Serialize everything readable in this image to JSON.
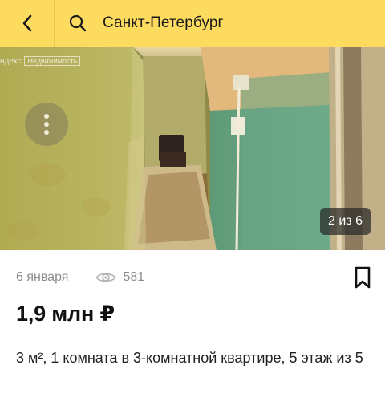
{
  "header": {
    "back_icon": "chevron-left-icon",
    "search_icon": "search-icon",
    "city": "Санкт-Петербург",
    "background_color": "#fddb5f"
  },
  "gallery": {
    "watermark_brand": "ндекс",
    "watermark_label": "Недвижимость",
    "more_icon": "vertical-dots-icon",
    "counter": "2 из 6"
  },
  "listing": {
    "date": "6 января",
    "views_icon": "eye-icon",
    "views": "581",
    "bookmark_icon": "bookmark-icon",
    "price": "1,9 млн ₽",
    "description": "3 м², 1 комната в 3-комнатной квартире, 5 этаж из 5"
  }
}
